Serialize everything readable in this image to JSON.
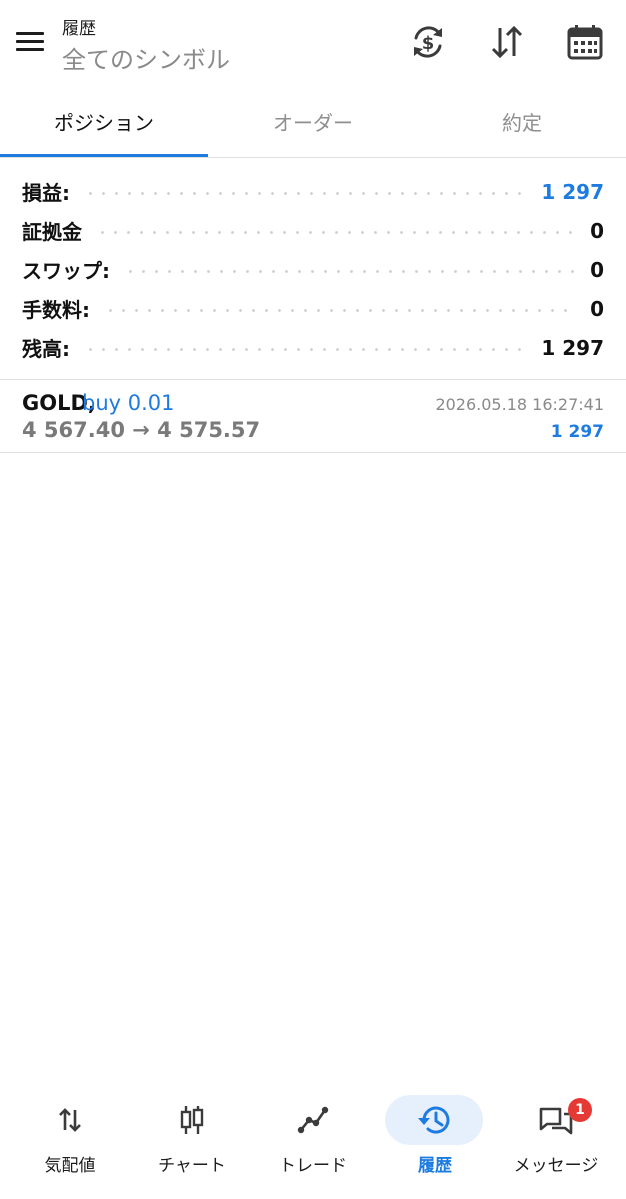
{
  "header": {
    "title": "履歴",
    "subtitle": "全てのシンボル",
    "icons": [
      "menu-icon",
      "currency-exchange-icon",
      "sort-icon",
      "calendar-icon"
    ]
  },
  "tabs": [
    {
      "label": "ポジション",
      "active": true
    },
    {
      "label": "オーダー",
      "active": false
    },
    {
      "label": "約定",
      "active": false
    }
  ],
  "summary": [
    {
      "label": "損益:",
      "value": "1 297",
      "highlight": true
    },
    {
      "label": "証拠金",
      "value": "0",
      "highlight": false
    },
    {
      "label": "スワップ:",
      "value": "0",
      "highlight": false
    },
    {
      "label": "手数料:",
      "value": "0",
      "highlight": false
    },
    {
      "label": "残高:",
      "value": "1 297",
      "highlight": false
    }
  ],
  "trade": {
    "symbol": "GOLD,",
    "side": "buy 0.01",
    "prices": "4 567.40 → 4 575.57",
    "time": "2026.05.18 16:27:41",
    "profit": "1 297"
  },
  "bottom_nav": [
    {
      "label": "気配値",
      "icon": "quotes-icon",
      "active": false
    },
    {
      "label": "チャート",
      "icon": "candlestick-chart-icon",
      "active": false
    },
    {
      "label": "トレード",
      "icon": "trade-line-icon",
      "active": false
    },
    {
      "label": "履歴",
      "icon": "history-icon",
      "active": true
    },
    {
      "label": "メッセージ",
      "icon": "messages-icon",
      "active": false,
      "badge": "1"
    }
  ],
  "colors": {
    "accent": "#1e7be0",
    "text": "#111111",
    "muted": "#8a8a8a",
    "badge": "#e53935",
    "active_pill": "#e6f0fc"
  }
}
